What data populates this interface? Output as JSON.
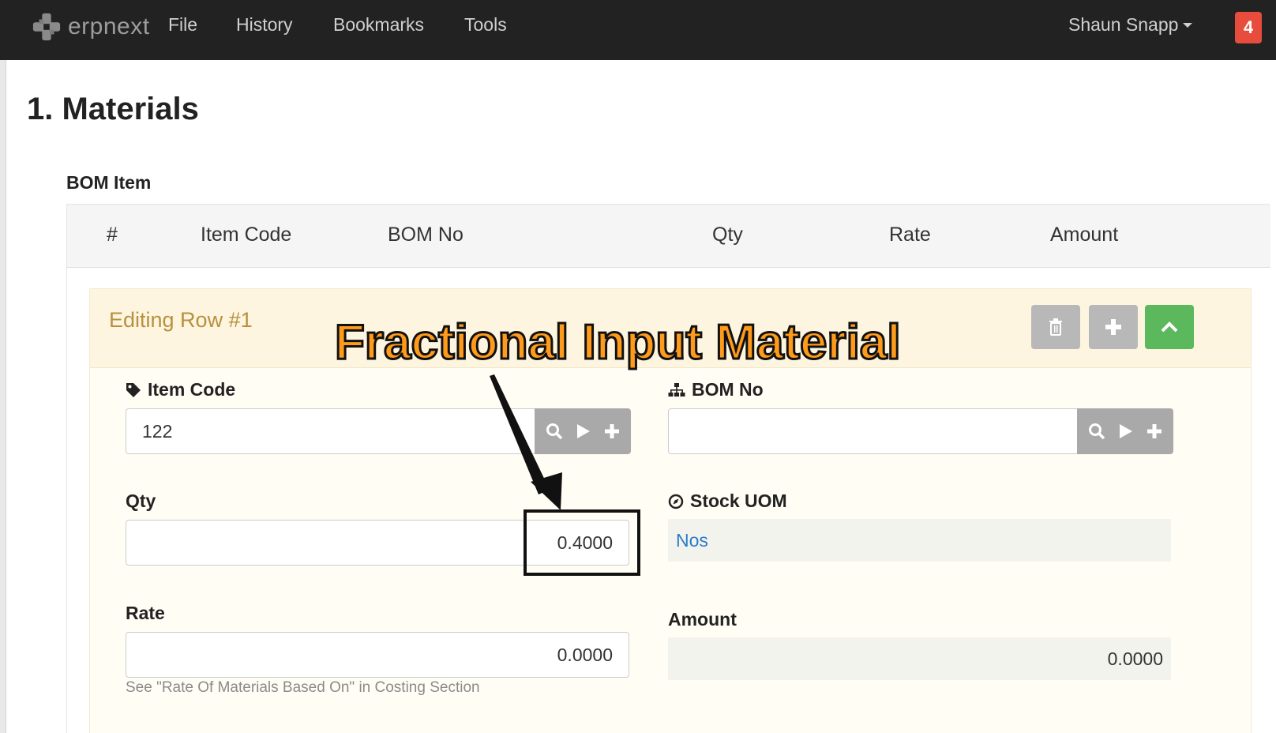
{
  "navbar": {
    "brand": "erpnext",
    "menu": [
      "File",
      "History",
      "Bookmarks",
      "Tools"
    ],
    "user": "Shaun Snapp",
    "notifications": "4"
  },
  "section": {
    "title": "1. Materials"
  },
  "grid": {
    "label": "BOM Item",
    "columns": [
      "#",
      "Item Code",
      "BOM No",
      "Qty",
      "Rate",
      "Amount"
    ]
  },
  "edit_row": {
    "title": "Editing Row #1",
    "fields": {
      "item_code": {
        "label": "Item Code",
        "value": "122",
        "icon": "tag-icon"
      },
      "bom_no": {
        "label": "BOM No",
        "value": "",
        "icon": "sitemap-icon"
      },
      "qty": {
        "label": "Qty",
        "value": "0.4000"
      },
      "stock_uom": {
        "label": "Stock UOM",
        "value": "Nos",
        "icon": "compass-icon"
      },
      "rate": {
        "label": "Rate",
        "value": "0.0000",
        "help": "See \"Rate Of Materials Based On\" in Costing Section"
      },
      "amount": {
        "label": "Amount",
        "value": "0.0000"
      }
    }
  },
  "annotation": {
    "text": "Fractional Input Material"
  },
  "colors": {
    "navbar": "#222222",
    "badge": "#e74c3c",
    "green": "#5cb85c",
    "annotation": "#ff9b1a",
    "link": "#2b7bc7"
  }
}
